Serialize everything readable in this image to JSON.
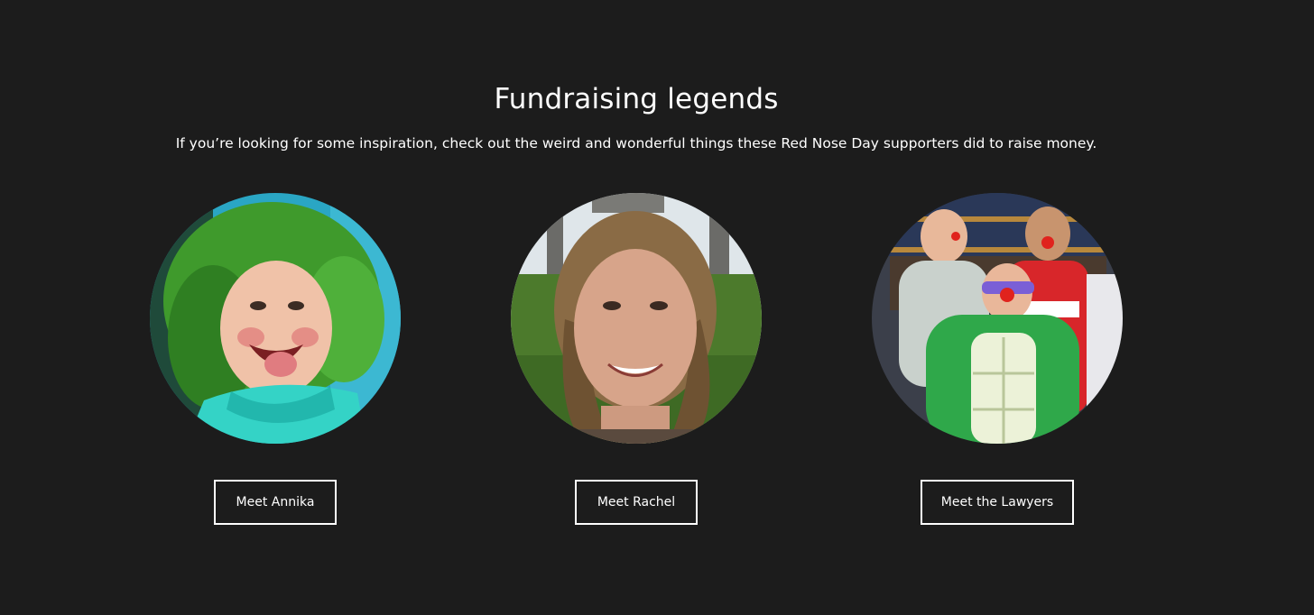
{
  "section": {
    "title": "Fundraising legends",
    "subtitle": "If you’re looking for some inspiration, check out the weird and wonderful things these Red Nose Day supporters did to raise money."
  },
  "legends": [
    {
      "button_label": "Meet Annika",
      "photo": "girl-green-hair-photo"
    },
    {
      "button_label": "Meet Rachel",
      "photo": "smiling-woman-photo"
    },
    {
      "button_label": "Meet the Lawyers",
      "photo": "lawyers-red-noses-photo"
    }
  ],
  "colors": {
    "background": "#1c1c1c",
    "text": "#ffffff",
    "red_nose": "#e0231d"
  }
}
